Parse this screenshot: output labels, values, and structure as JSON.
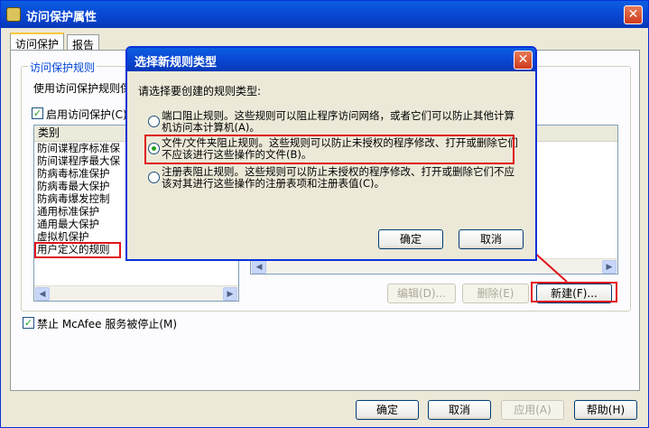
{
  "window": {
    "title": "访问保护属性",
    "close": "✕"
  },
  "tabs": [
    "访问保护",
    "报告"
  ],
  "group": {
    "label": "访问保护规则",
    "desc": "使用访问保护规则保",
    "enable_label": "启用访问保护(C)"
  },
  "left_list": {
    "header": "类别",
    "items": [
      "防间谍程序标准保",
      "防间谍程序最大保",
      "防病毒标准保护",
      "防病毒最大保护",
      "防病毒爆发控制",
      "通用标准保护",
      "通用最大保护",
      "虚拟机保护",
      "用户定义的规则"
    ]
  },
  "right_buttons": {
    "edit": "编辑(D)...",
    "delete": "删除(E)",
    "new": "新建(F)..."
  },
  "disable_stop_label": "禁止 McAfee 服务被停止(M)",
  "bottom_buttons": {
    "ok": "确定",
    "cancel": "取消",
    "apply": "应用(A)",
    "help": "帮助(H)"
  },
  "dialog": {
    "title": "选择新规则类型",
    "prompt": "请选择要创建的规则类型:",
    "options": [
      "端口阻止规则。这些规则可以阻止程序访问网络，或者它们可以防止其他计算机访问本计算机(A)。",
      "文件/文件夹阻止规则。这些规则可以防止未授权的程序修改、打开或删除它们不应该进行这些操作的文件(B)。",
      "注册表阻止规则。这些规则可以防止未授权的程序修改、打开或删除它们不应该对其进行这些操作的注册表项和注册表值(C)。"
    ],
    "selected_index": 1,
    "ok": "确定",
    "cancel": "取消"
  },
  "colors": {
    "highlight": "#e0141a",
    "titlebar": "#0a49d6"
  }
}
